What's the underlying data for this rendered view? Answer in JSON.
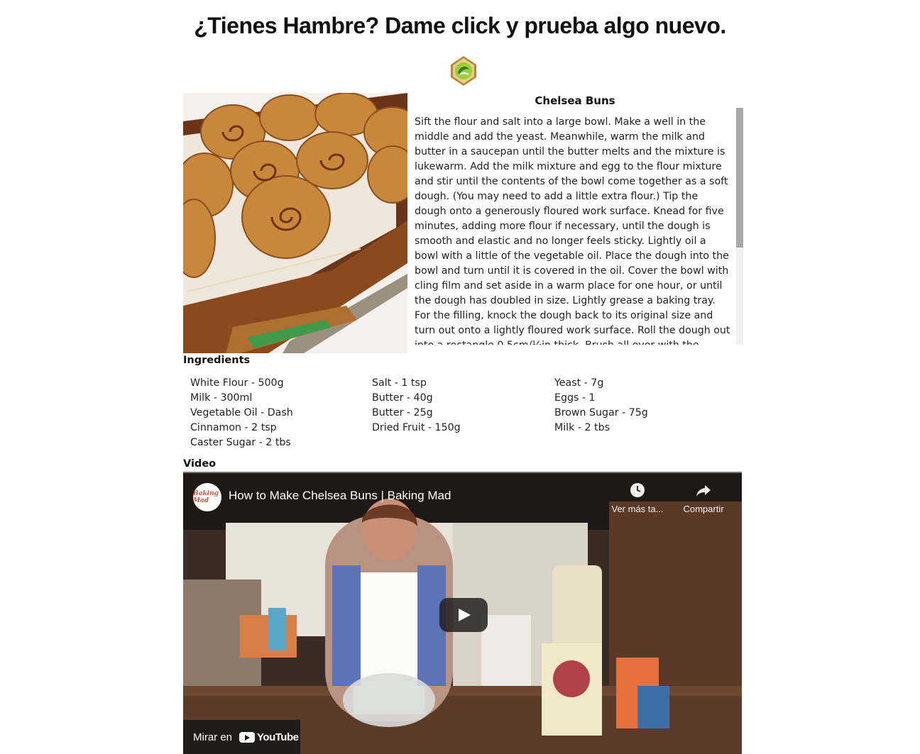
{
  "page": {
    "heading": "¿Tienes Hambre? Dame click y prueba algo nuevo."
  },
  "recipe": {
    "title": "Chelsea Buns",
    "instructions": "Sift the flour and salt into a large bowl. Make a well in the middle and add the yeast. Meanwhile, warm the milk and butter in a saucepan until the butter melts and the mixture is lukewarm. Add the milk mixture and egg to the flour mixture and stir until the contents of the bowl come together as a soft dough. (You may need to add a little extra flour.) Tip the dough onto a generously floured work surface. Knead for five minutes, adding more flour if necessary, until the dough is smooth and elastic and no longer feels sticky. Lightly oil a bowl with a little of the vegetable oil. Place the dough into the bowl and turn until it is covered in the oil. Cover the bowl with cling film and set aside in a warm place for one hour, or until the dough has doubled in size. Lightly grease a baking tray. For the filling, knock the dough back to its original size and turn out onto a lightly floured work surface. Roll the dough out into a rectangle 0.5cm/¼in thick. Brush all over with the melted butter, then"
  },
  "ingredients_label": "Ingredients",
  "ingredients": {
    "col1": [
      "White Flour - 500g",
      "Milk - 300ml",
      "Vegetable Oil - Dash",
      "Cinnamon - 2 tsp",
      "Caster Sugar - 2 tbs"
    ],
    "col2": [
      "Salt - 1 tsp",
      "Butter - 40g",
      "Butter - 25g",
      "Dried Fruit - 150g"
    ],
    "col3": [
      "Yeast - 7g",
      "Eggs - 1",
      "Brown Sugar - 75g",
      "Milk - 2 tbs"
    ]
  },
  "video_label": "Video",
  "video": {
    "title": "How to Make Chelsea Buns | Baking Mad",
    "channel_logo_text": "Baking Mad",
    "watch_later": "Ver más ta...",
    "share": "Compartir",
    "watch_on": "Mirar en",
    "youtube": "YouTube"
  }
}
